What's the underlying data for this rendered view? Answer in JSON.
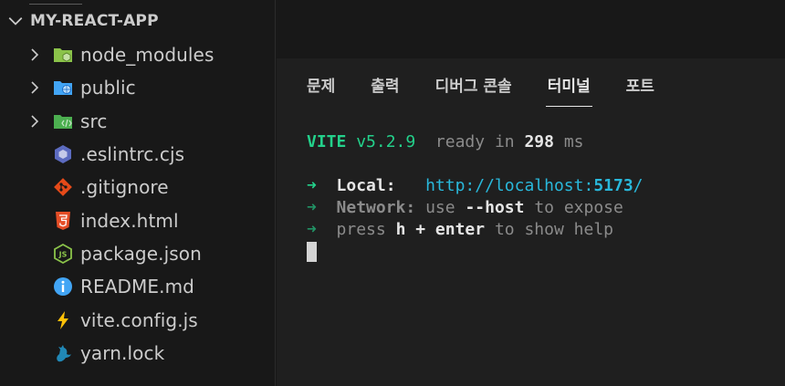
{
  "explorer": {
    "section_title": "MY-REACT-APP",
    "items": [
      {
        "name": "node_modules",
        "kind": "folder",
        "icon": "node-modules-folder-icon",
        "color": "#8bc34a"
      },
      {
        "name": "public",
        "kind": "folder",
        "icon": "public-folder-icon",
        "color": "#42a5f5"
      },
      {
        "name": "src",
        "kind": "folder",
        "icon": "src-folder-icon",
        "color": "#4caf50"
      },
      {
        "name": ".eslintrc.cjs",
        "kind": "file",
        "icon": "eslint-icon",
        "color": "#5c6bc0"
      },
      {
        "name": ".gitignore",
        "kind": "file",
        "icon": "git-icon",
        "color": "#e64a19"
      },
      {
        "name": "index.html",
        "kind": "file",
        "icon": "html-icon",
        "color": "#e44d26"
      },
      {
        "name": "package.json",
        "kind": "file",
        "icon": "nodejs-icon",
        "color": "#8bc34a"
      },
      {
        "name": "README.md",
        "kind": "file",
        "icon": "info-icon",
        "color": "#42a5f5"
      },
      {
        "name": "vite.config.js",
        "kind": "file",
        "icon": "vite-icon",
        "color": "#ffc107"
      },
      {
        "name": "yarn.lock",
        "kind": "file",
        "icon": "yarn-icon",
        "color": "#2188b6"
      }
    ]
  },
  "panel": {
    "tabs": [
      "문제",
      "출력",
      "디버그 콘솔",
      "터미널",
      "포트"
    ],
    "active_tab": "터미널"
  },
  "terminal": {
    "vite_name": "VITE",
    "vite_version": "v5.2.9",
    "ready_text": "ready in",
    "ready_ms": "298",
    "ready_unit": "ms",
    "arrow": "➜",
    "local_label": "Local:",
    "local_url_prefix": "http://localhost:",
    "local_port": "5173",
    "local_url_suffix": "/",
    "network_label": "Network:",
    "network_use": "use",
    "network_flag": "--host",
    "network_rest": "to expose",
    "help_press": "press",
    "help_key": "h + enter",
    "help_rest": "to show help"
  },
  "colors": {
    "background": "#181818",
    "panel_background": "#1f1f1f",
    "terminal_green": "#23d18b",
    "terminal_cyan": "#29b8db"
  }
}
